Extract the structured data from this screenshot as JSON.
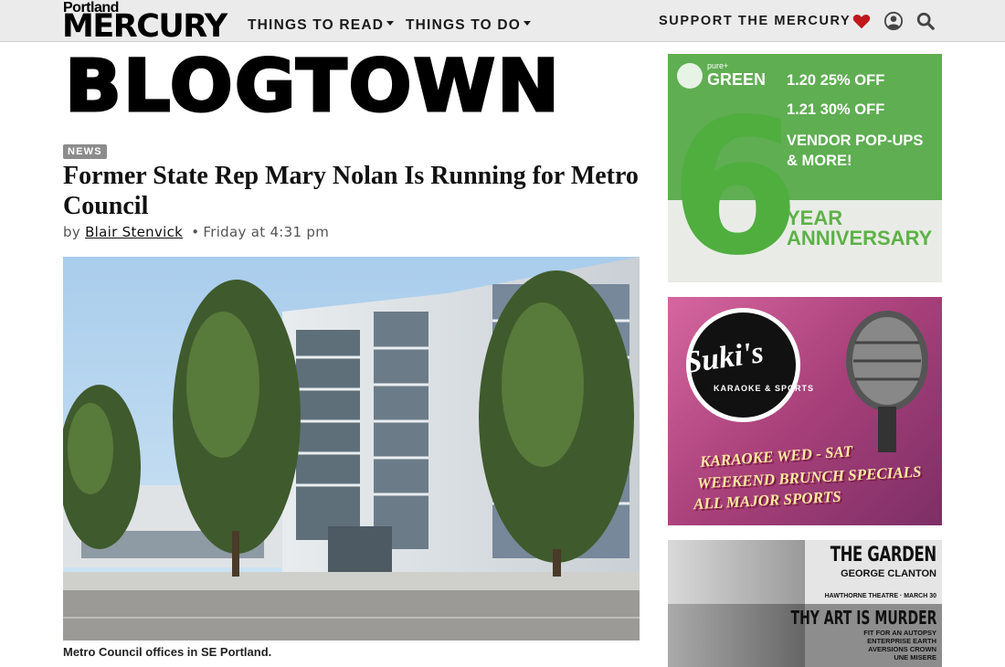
{
  "header": {
    "logo_top": "Portland",
    "logo_bottom": "MERCURY",
    "nav": [
      {
        "label": "THINGS TO READ"
      },
      {
        "label": "THINGS TO DO"
      }
    ],
    "support_label": "SUPPORT THE MERCURY",
    "icons": [
      "heart-icon",
      "user-icon",
      "search-icon"
    ],
    "heart_color": "#c0171d"
  },
  "section": {
    "title": "BLOGTOWN"
  },
  "article": {
    "category": "NEWS",
    "headline": "Former State Rep Mary Nolan Is Running for Metro Council",
    "byline_prefix": "by",
    "author": "Blair Stenvick",
    "separator": "•",
    "timestamp": "Friday at 4:31 pm",
    "caption": "Metro Council offices in SE Portland."
  },
  "ads": {
    "green": {
      "brand_small": "pure+",
      "brand": "GREEN",
      "lines": [
        "1.20 25% OFF",
        "1.21 30% OFF",
        "VENDOR POP-UPS",
        "& MORE!"
      ],
      "big_number": "6",
      "year": "YEAR",
      "anniversary": "ANNIVERSARY"
    },
    "sukis": {
      "name": "Suki's",
      "sub": "KARAOKE & SPORTS",
      "lines": [
        "KARAOKE WED - SAT",
        "WEEKEND BRUNCH SPECIALS",
        "ALL MAJOR SPORTS"
      ]
    },
    "concert": {
      "band1": "THE GARDEN",
      "band1_support": "GEORGE CLANTON",
      "band1_info": "HAWTHORNE THEATRE · MARCH 30",
      "band2": "THY ART IS MURDER",
      "band2_support": [
        "FIT FOR AN AUTOPSY",
        "ENTERPRISE EARTH",
        "AVERSIONS CROWN",
        "UNE MISERE"
      ]
    }
  },
  "colors": {
    "header_bg": "#ebebeb",
    "badge_bg": "#8c8c8c",
    "green_ad": "#5fae52",
    "suki_pink": "#c0467f"
  }
}
